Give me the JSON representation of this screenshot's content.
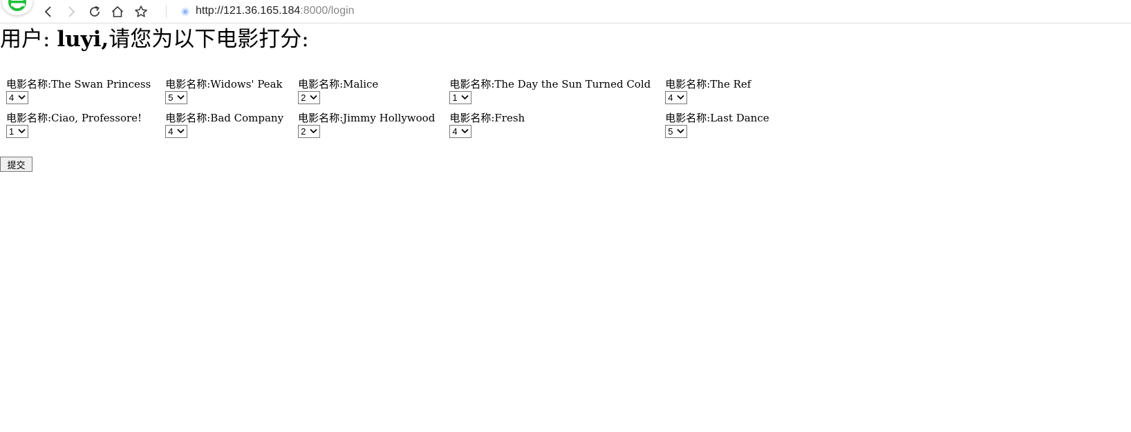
{
  "browser": {
    "url_host": "http://121.36.165.184",
    "url_rest": ":8000/login",
    "icons": [
      "browser-logo-icon",
      "back-icon",
      "forward-icon",
      "reload-icon",
      "home-icon",
      "bookmark-star-icon",
      "site-info-icon"
    ],
    "accent_color": "#1fbf3a"
  },
  "header": {
    "prefix": "用户: ",
    "username": "luyi,",
    "suffix": "请您为以下电影打分:"
  },
  "movies": [
    {
      "label": "电影名称:The Swan Princess",
      "rating": "4"
    },
    {
      "label": "电影名称:Widows' Peak",
      "rating": "5"
    },
    {
      "label": "电影名称:Malice",
      "rating": "2"
    },
    {
      "label": "电影名称:The Day the Sun Turned Cold",
      "rating": "1"
    },
    {
      "label": "电影名称:The Ref",
      "rating": "4"
    },
    {
      "label": "电影名称:Ciao, Professore!",
      "rating": "1"
    },
    {
      "label": "电影名称:Bad Company",
      "rating": "4"
    },
    {
      "label": "电影名称:Jimmy Hollywood",
      "rating": "2"
    },
    {
      "label": "电影名称:Fresh",
      "rating": "4"
    },
    {
      "label": "电影名称:Last Dance",
      "rating": "5"
    }
  ],
  "submit_label": "提交"
}
